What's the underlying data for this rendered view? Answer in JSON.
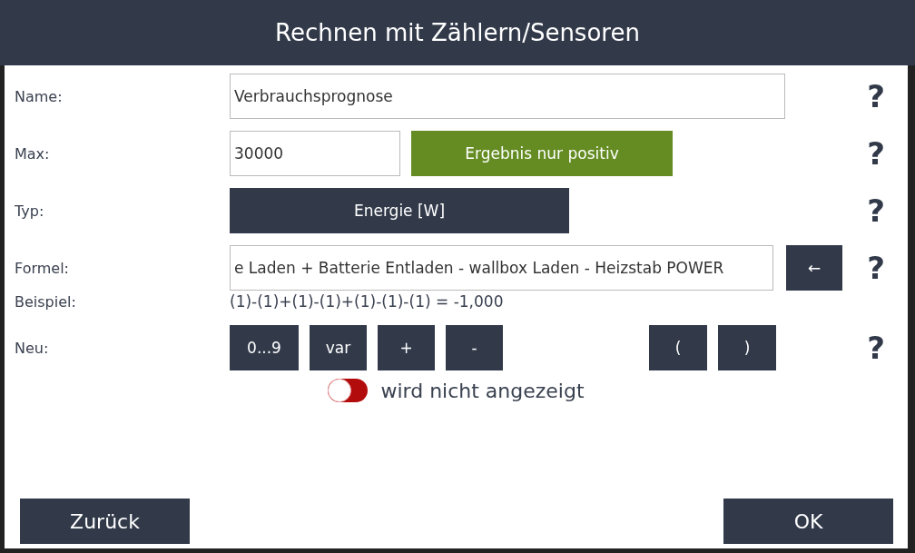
{
  "window": {
    "title": "Rechnen mit Zählern/Sensoren"
  },
  "fields": [
    {
      "kind": "input",
      "label": "Name:",
      "value": "Verbrauchsprognose",
      "help": "?"
    },
    {
      "kind": "max",
      "label": "Max:",
      "value": "30000",
      "option": {
        "label": "Ergebnis nur positiv",
        "on": true
      },
      "help": "?"
    },
    {
      "kind": "select",
      "label": "Typ:",
      "value": "Energie [W]",
      "help": "?"
    },
    {
      "kind": "formula",
      "label": "Formel:",
      "value": "e Laden + Batterie Entladen - wallbox Laden - Heizstab POWER",
      "backspace": "←",
      "help": "?"
    },
    {
      "kind": "example",
      "label": "Beispiel:",
      "value": "(1)-(1)+(1)-(1)+(1)-(1)-(1) = -1,000"
    }
  ],
  "new": {
    "label": "Neu:",
    "operators": [
      "0...9",
      "var",
      "+",
      "-"
    ],
    "brackets": [
      "(",
      ")"
    ],
    "help": "?"
  },
  "display_toggle": {
    "on": false,
    "label": "wird nicht angezeigt"
  },
  "buttons": {
    "back": "Zurück",
    "ok": "OK"
  }
}
